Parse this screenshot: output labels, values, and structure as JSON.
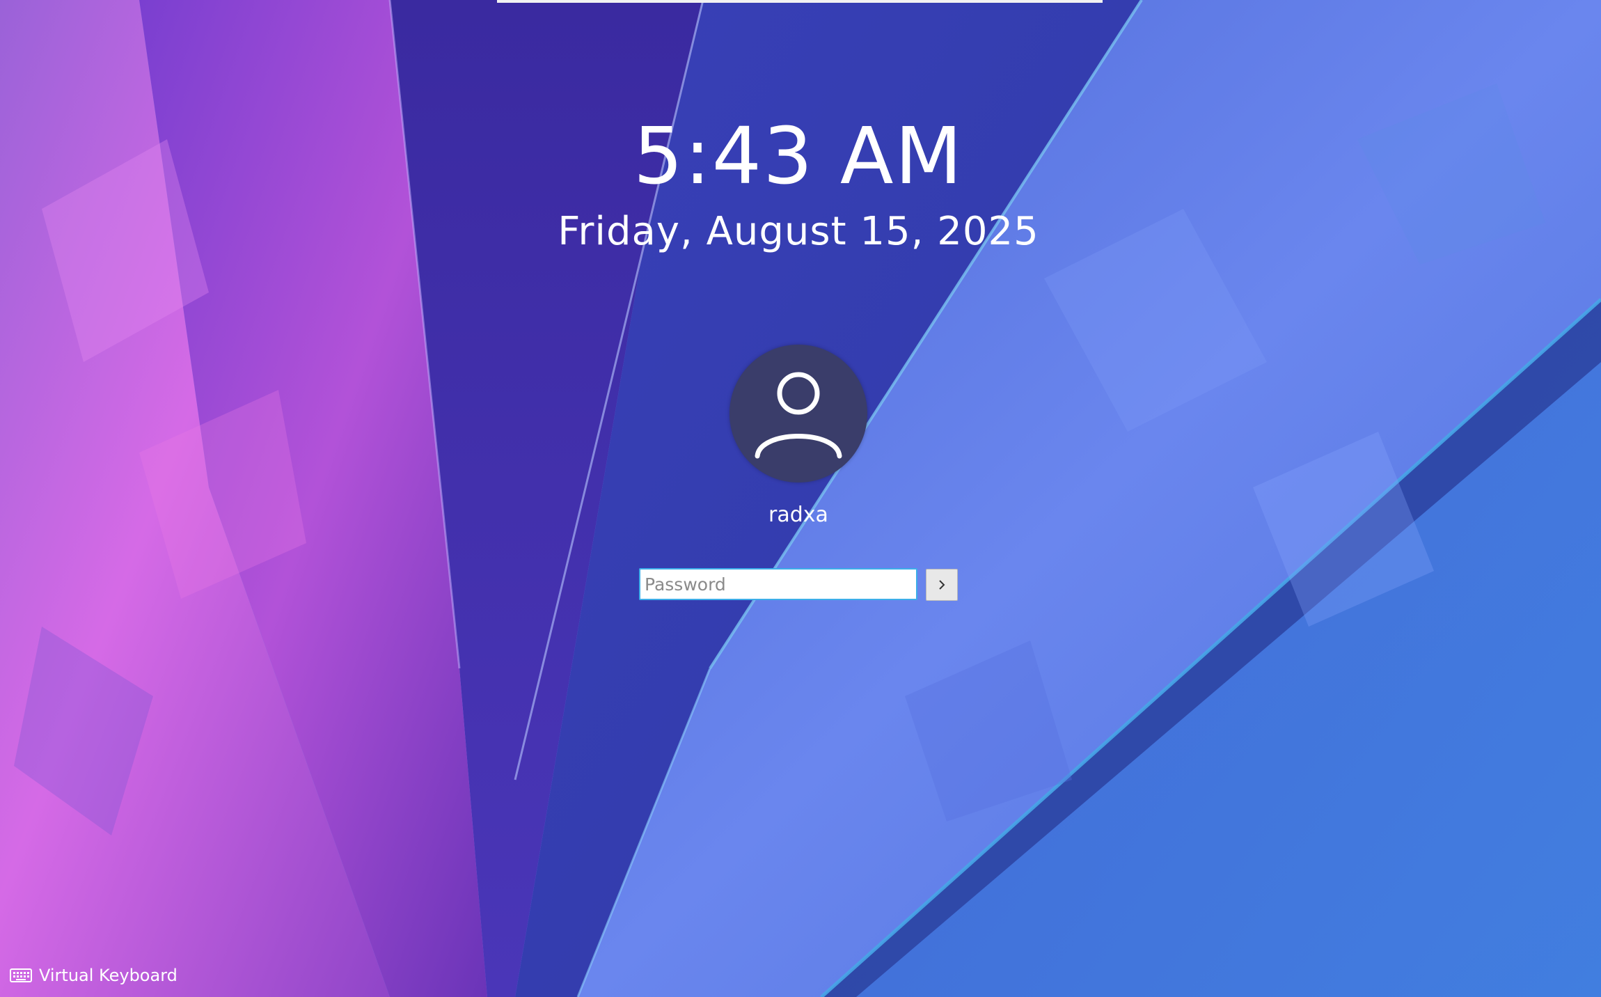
{
  "lockscreen": {
    "time": "5:43 AM",
    "date": "Friday, August 15, 2025",
    "user": {
      "name": "radxa",
      "avatar_icon": "user-silhouette-icon"
    },
    "password_field": {
      "placeholder": "Password",
      "value": ""
    },
    "submit_icon": "chevron-right-icon",
    "virtual_keyboard": {
      "label": "Virtual Keyboard",
      "icon": "keyboard-icon"
    }
  },
  "colors": {
    "accent": "#3daee9",
    "avatar_background": "#3a3d6a",
    "text": "#ffffff"
  }
}
